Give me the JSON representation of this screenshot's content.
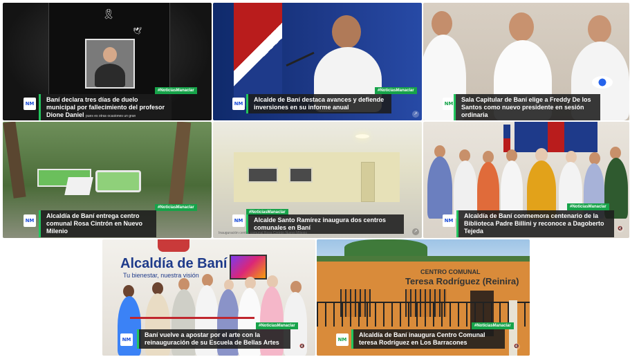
{
  "tag_label": "#NoticiasManaclar",
  "logo_text": "NM",
  "tiles": [
    {
      "caption": "Baní declara tres días de duelo municipal por fallecimiento del profesor Dione Daniel",
      "subcaption": "pues es otras ocasiones un gran",
      "colors": {
        "bg": "#1f1f1f",
        "accent": "#2d2d2d"
      }
    },
    {
      "caption": "Alcalde de Baní destaca avances y defiende inversiones en su informe anual",
      "colors": {
        "bg": "#1e3a8a",
        "accent": "#b91c1c"
      }
    },
    {
      "caption": "Sala Capitular de Baní elige a Freddy De los Santos como nuevo presidente en sesión ordinaria",
      "colors": {
        "bg": "#d9d0c4",
        "accent": "#f5f5f5"
      }
    },
    {
      "caption": "Alcaldía de Baní entrega centro comunal Rosa Cintrón en Nuevo Milenio",
      "colors": {
        "bg": "#4d6b3a",
        "accent": "#7fb26a"
      }
    },
    {
      "caption": "Alcalde Santo Ramírez inaugura dos centros comunales en Baní",
      "subcaption": "Inauguración centro comunal Rosa Cintrón Nuevo Milenio",
      "colors": {
        "bg": "#cfcab3",
        "accent": "#ece9d8"
      }
    },
    {
      "caption": "Alcaldía de Baní conmemora centenario de la Biblioteca Padre Billini y reconoce a Dagoberto Tejeda",
      "colors": {
        "bg": "#e7e2dc",
        "accent": "#1e3a8a"
      }
    },
    {
      "caption": "Baní vuelve a apostar por el arte con la reinauguración de su Escuela de Bellas Artes",
      "sign_title": "Alcaldía de Baní",
      "sign_sub": "Tu bienestar, nuestra visión",
      "colors": {
        "bg": "#ece9e4",
        "accent": "#1e3a8a"
      }
    },
    {
      "caption": "Alcaldía de Baní inaugura Centro Comunal teresa Rodríguez en Los Barracones",
      "building_label": "CENTRO COMUNAL",
      "building_name": "Teresa Rodríguez (Reinira)",
      "colors": {
        "bg": "#8fb7d9",
        "accent": "#d98b3a"
      }
    }
  ]
}
